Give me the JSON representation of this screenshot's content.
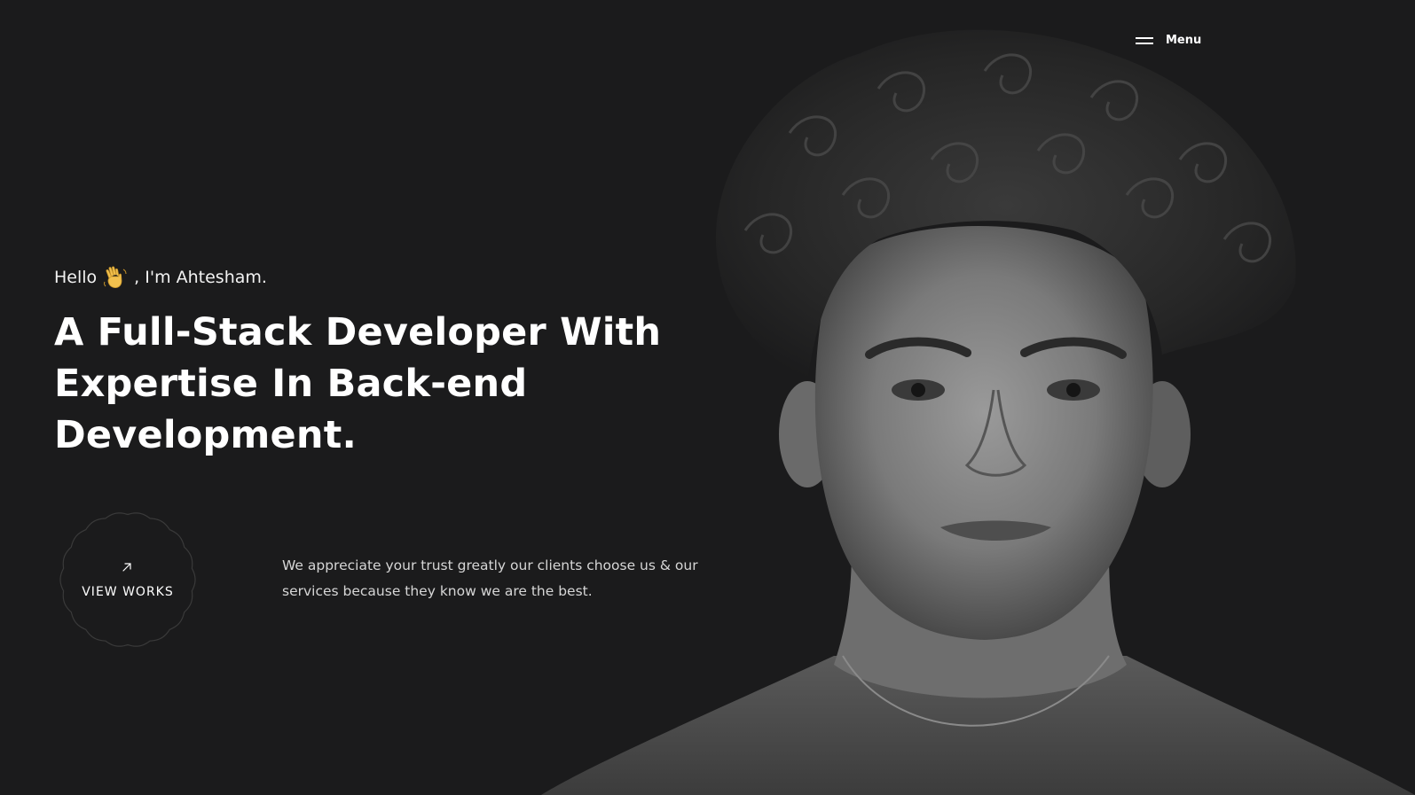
{
  "nav": {
    "menu_label": "Menu",
    "menu_icon": "hamburger-icon"
  },
  "hero": {
    "greeting_before": "Hello",
    "greeting_emoji": "waving-hand-icon",
    "greeting_after": ", I'm Ahtesham.",
    "headline": "A Full-Stack Developer With Expertise In Back-end Development.",
    "cta_label": "VIEW WORKS",
    "cta_icon": "arrow-up-right-icon",
    "description": "We appreciate your trust greatly our clients choose us & our services because they know we are the best."
  },
  "colors": {
    "background": "#1b1b1c",
    "text": "#ffffff",
    "muted_text": "#d6d6d6",
    "emoji": "#f2c14e"
  }
}
